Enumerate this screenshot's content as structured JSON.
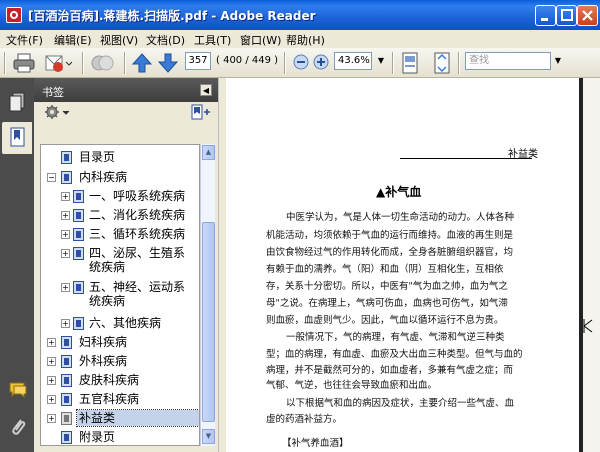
{
  "window": {
    "title": "[百酒治百病].蒋建栋.扫描版.pdf - Adobe Reader"
  },
  "menu": [
    "文件(F)",
    "编辑(E)",
    "视图(V)",
    "文档(D)",
    "工具(T)",
    "窗口(W)",
    "帮助(H)"
  ],
  "toolbar": {
    "page_number": "357",
    "page_count": "( 400 / 449 )",
    "zoom": "43.6%",
    "search_placeholder": "查找"
  },
  "panel": {
    "title": "书签"
  },
  "bookmarks": [
    {
      "label": "目录页",
      "expander": "",
      "icon": "normal",
      "selected": false
    },
    {
      "label": "内科疾病",
      "expander": "−",
      "icon": "normal",
      "selected": false
    },
    {
      "label": "一、呼吸系统疾病",
      "expander": "+",
      "icon": "normal",
      "selected": false
    },
    {
      "label": "二、消化系统疾病",
      "expander": "+",
      "icon": "normal",
      "selected": false
    },
    {
      "label": "三、循环系统疾病",
      "expander": "+",
      "icon": "normal",
      "selected": false
    },
    {
      "label": "四、泌尿、生殖系统疾病",
      "line1": "四、泌尿、生殖系",
      "line2": "统疾病",
      "expander": "+",
      "icon": "normal",
      "selected": false
    },
    {
      "label": "五、神经、运动系统疾病",
      "line1": "五、神经、运动系",
      "line2": "统疾病",
      "expander": "+",
      "icon": "normal",
      "selected": false
    },
    {
      "label": "六、其他疾病",
      "expander": "+",
      "icon": "normal",
      "selected": false
    },
    {
      "label": "妇科疾病",
      "expander": "+",
      "icon": "normal",
      "selected": false
    },
    {
      "label": "外科疾病",
      "expander": "+",
      "icon": "normal",
      "selected": false
    },
    {
      "label": "皮肤科疾病",
      "expander": "+",
      "icon": "normal",
      "selected": false
    },
    {
      "label": "五官科疾病",
      "expander": "+",
      "icon": "normal",
      "selected": false
    },
    {
      "label": "补益类",
      "expander": "+",
      "icon": "grey",
      "selected": true
    },
    {
      "label": "附录页",
      "expander": "",
      "icon": "normal",
      "selected": false
    }
  ],
  "document": {
    "running_header": "补益类",
    "heading": "▲补气血",
    "paragraphs": [
      "中医学认为，气是人体一切生命活动的动力。人体各种",
      "机能活动，均须依赖于气血的运行而维持。血液的再生则是",
      "由饮食物经过气的作用转化而成，全身各脏腑组织器官，均",
      "有赖于血的濡养。气（阳）和血（阴）互相化生，互相依",
      "存，关系十分密切。所以，中医有\"气为血之帅，血为气之",
      "母\"之说。在病理上，气病可伤血，血病也可伤气，如气滞",
      "则血瘀，血虚则气少。因此，气血以循环运行不息为贵。",
      "一般情况下，气的病理，有气虚、气滞和气逆三种类",
      "型；血的病理，有血虚、血瘀及大出血三种类型。但气与血的",
      "病理，并不是截然可分的，如血虚者，多兼有气虚之症；而",
      "气郁、气逆，也往往会导致血瘀和出血。",
      "以下根据气和血的病因及症状，主要介绍一些气虚、血",
      "虚的药酒补益方。",
      "【补气养血酒】"
    ]
  }
}
